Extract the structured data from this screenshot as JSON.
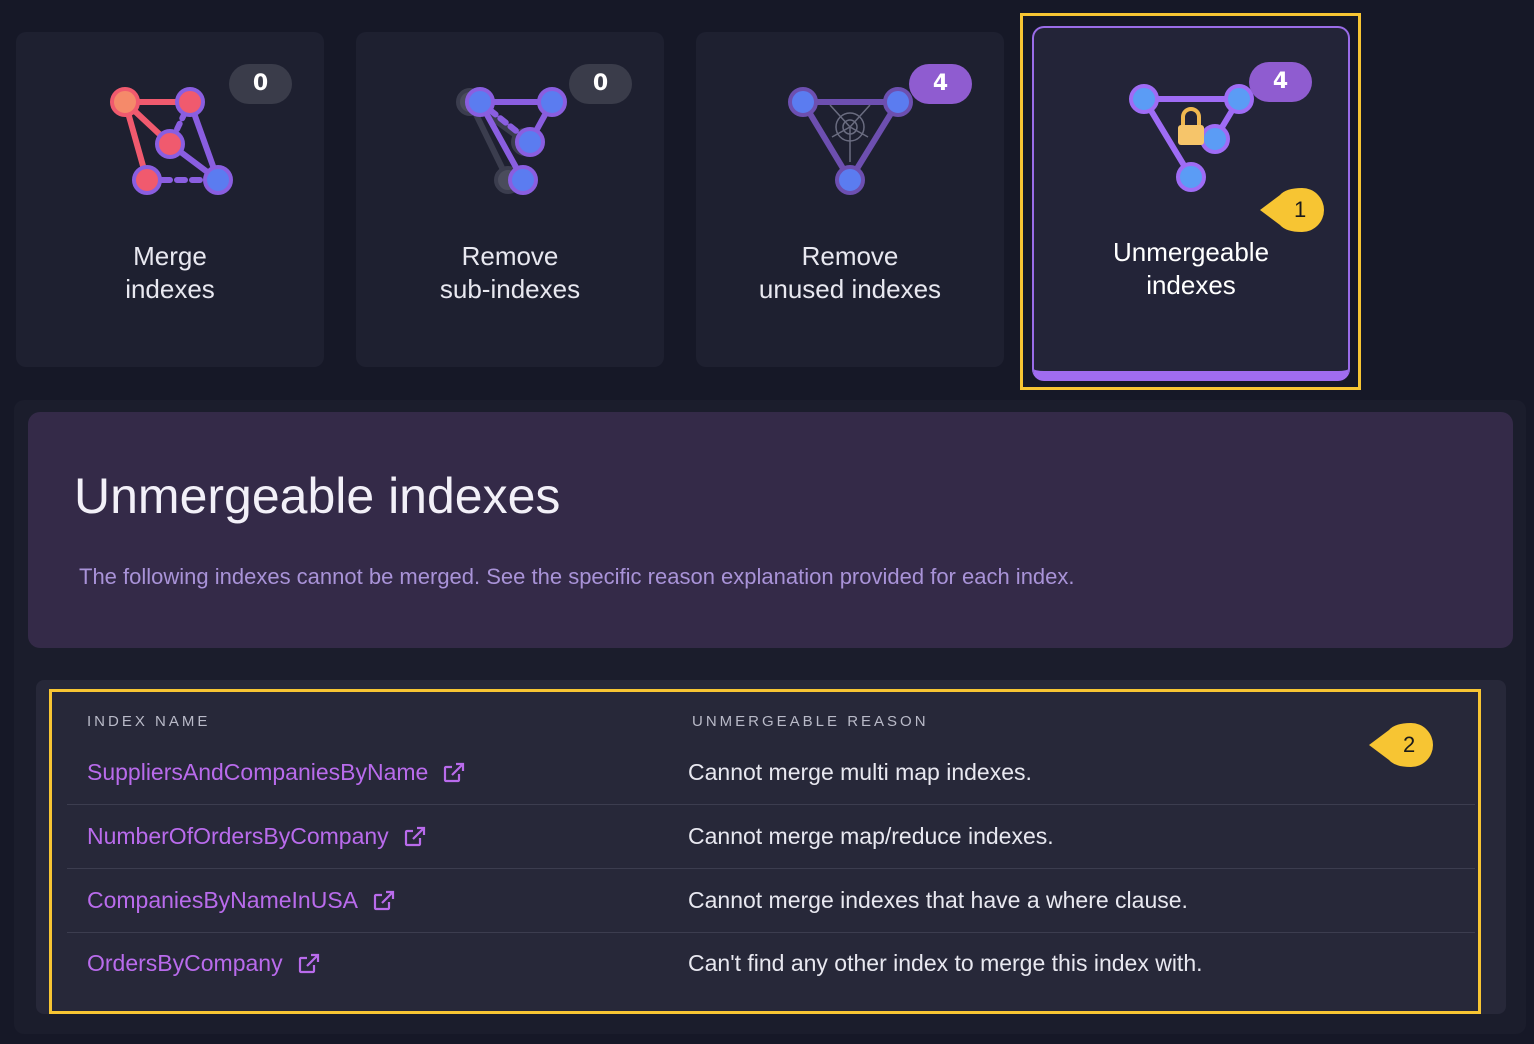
{
  "cards": [
    {
      "line1": "Merge",
      "line2": "indexes",
      "count": "0",
      "icon": "merge-graph-icon"
    },
    {
      "line1": "Remove",
      "line2": "sub-indexes",
      "count": "0",
      "icon": "sub-index-graph-icon"
    },
    {
      "line1": "Remove",
      "line2": "unused indexes",
      "count": "4",
      "icon": "cobweb-graph-icon"
    },
    {
      "line1": "Unmergeable",
      "line2": "indexes",
      "count": "4",
      "icon": "locked-graph-icon",
      "selected": true
    }
  ],
  "callouts": [
    "1",
    "2"
  ],
  "hero": {
    "title": "Unmergeable indexes",
    "description": "The following indexes cannot be merged. See the specific reason explanation provided for each index."
  },
  "table": {
    "columns": [
      "INDEX NAME",
      "UNMERGEABLE REASON"
    ],
    "rows": [
      {
        "name": "SuppliersAndCompaniesByName",
        "reason": "Cannot merge multi map indexes."
      },
      {
        "name": "NumberOfOrdersByCompany",
        "reason": "Cannot merge map/reduce indexes."
      },
      {
        "name": "CompaniesByNameInUSA",
        "reason": "Cannot merge indexes that have a where clause."
      },
      {
        "name": "OrdersByCompany",
        "reason": "Can't find any other index to merge this index with."
      }
    ]
  },
  "colors": {
    "accent": "#a06cf0",
    "link": "#b96bec",
    "highlight": "#f7c533",
    "node_blue": "#5b7cf0",
    "node_red": "#f05a6e"
  }
}
